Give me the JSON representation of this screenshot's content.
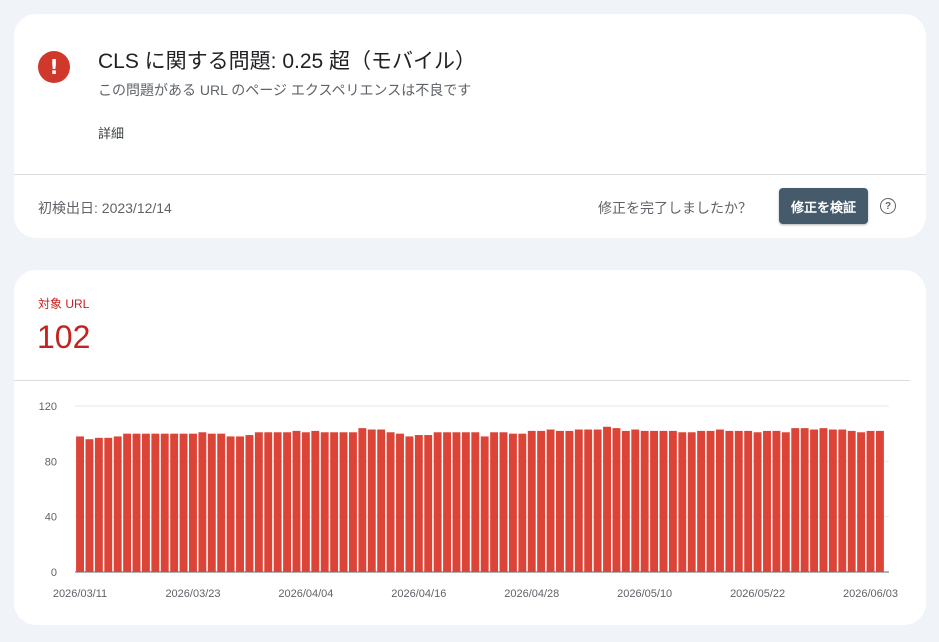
{
  "issue": {
    "title": "CLS に関する問題: 0.25 超（モバイル）",
    "subtitle": "この問題がある URL のページ エクスペリエンスは不良です",
    "details_label": "詳細",
    "first_detected": "初検出日: 2023/12/14",
    "fix_question": "修正を完了しましたか？",
    "validate_label": "修正を検証",
    "error_icon_glyph": "!",
    "help_icon_glyph": "?",
    "error_color": "#d0382b"
  },
  "metric": {
    "label": "対象 URL",
    "value": "102",
    "color": "#c5221f"
  },
  "chart_data": {
    "type": "bar",
    "title": "",
    "xlabel": "",
    "ylabel": "",
    "ylim": [
      0,
      120
    ],
    "y_ticks": [
      0,
      40,
      80,
      120
    ],
    "bar_color": "#db4437",
    "x_start": "2026-03-11",
    "x_tick_labels": [
      "2026/03/11",
      "2026/03/23",
      "2026/04/04",
      "2026/04/16",
      "2026/04/28",
      "2026/05/10",
      "2026/05/22",
      "2026/06/03"
    ],
    "values": [
      98,
      96,
      97,
      97,
      98,
      100,
      100,
      100,
      100,
      100,
      100,
      100,
      100,
      101,
      100,
      100,
      98,
      98,
      99,
      101,
      101,
      101,
      101,
      102,
      101,
      102,
      101,
      101,
      101,
      101,
      104,
      103,
      103,
      101,
      100,
      98,
      99,
      99,
      101,
      101,
      101,
      101,
      101,
      98,
      101,
      101,
      100,
      100,
      102,
      102,
      103,
      102,
      102,
      103,
      103,
      103,
      105,
      104,
      102,
      103,
      102,
      102,
      102,
      102,
      101,
      101,
      102,
      102,
      103,
      102,
      102,
      102,
      101,
      102,
      102,
      101,
      104,
      104,
      103,
      104,
      103,
      103,
      102,
      101,
      102,
      102
    ]
  }
}
